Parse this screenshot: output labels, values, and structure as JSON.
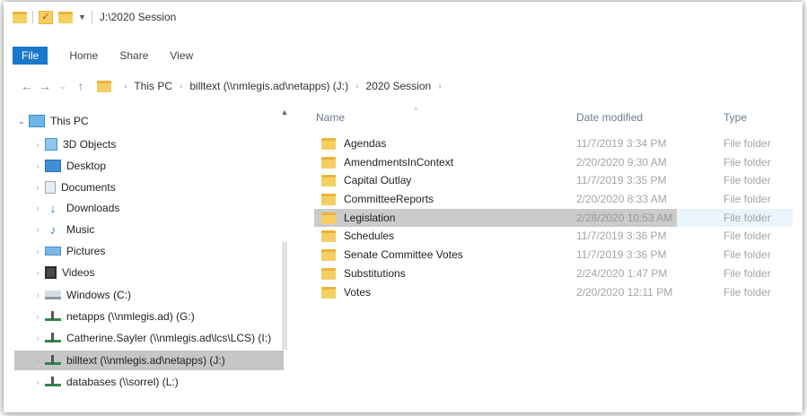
{
  "window": {
    "title": "J:\\2020 Session"
  },
  "ribbon": {
    "tabs": [
      "File",
      "Home",
      "Share",
      "View"
    ]
  },
  "address": {
    "crumbs": [
      "This PC",
      "billtext (\\\\nmlegis.ad\\netapps) (J:)",
      "2020 Session"
    ]
  },
  "nav": {
    "items": [
      {
        "label": "This PC",
        "icon": "pc-icon",
        "expanded": true
      },
      {
        "label": "3D Objects",
        "icon": "3d-objects-icon"
      },
      {
        "label": "Desktop",
        "icon": "desktop-icon"
      },
      {
        "label": "Documents",
        "icon": "documents-icon"
      },
      {
        "label": "Downloads",
        "icon": "downloads-icon"
      },
      {
        "label": "Music",
        "icon": "music-icon"
      },
      {
        "label": "Pictures",
        "icon": "pictures-icon"
      },
      {
        "label": "Videos",
        "icon": "videos-icon"
      },
      {
        "label": "Windows (C:)",
        "icon": "drive-icon"
      },
      {
        "label": "netapps (\\\\nmlegis.ad) (G:)",
        "icon": "network-drive-icon"
      },
      {
        "label": "Catherine.Sayler (\\\\nmlegis.ad\\lcs\\LCS) (I:)",
        "icon": "network-drive-icon"
      },
      {
        "label": "billtext (\\\\nmlegis.ad\\netapps) (J:)",
        "icon": "network-drive-icon",
        "selected": true
      },
      {
        "label": "databases (\\\\sorrel) (L:)",
        "icon": "network-drive-icon"
      }
    ]
  },
  "filelist": {
    "columns": {
      "name": "Name",
      "date": "Date modified",
      "type": "Type"
    },
    "rows": [
      {
        "name": "Agendas",
        "date": "11/7/2019 3:34 PM",
        "type": "File folder"
      },
      {
        "name": "AmendmentsInContext",
        "date": "2/20/2020 9:30 AM",
        "type": "File folder"
      },
      {
        "name": "Capital Outlay",
        "date": "11/7/2019 3:35 PM",
        "type": "File folder"
      },
      {
        "name": "CommitteeReports",
        "date": "2/20/2020 8:33 AM",
        "type": "File folder"
      },
      {
        "name": "Legislation",
        "date": "2/28/2020 10:53 AM",
        "type": "File folder",
        "selected": true
      },
      {
        "name": "Schedules",
        "date": "11/7/2019 3:36 PM",
        "type": "File folder"
      },
      {
        "name": "Senate Committee Votes",
        "date": "11/7/2019 3:36 PM",
        "type": "File folder"
      },
      {
        "name": "Substitutions",
        "date": "2/24/2020 1:47 PM",
        "type": "File folder"
      },
      {
        "name": "Votes",
        "date": "2/20/2020 12:11 PM",
        "type": "File folder"
      }
    ]
  },
  "colors": {
    "file_tab": "#1979ca",
    "selection": "#cbcbcb",
    "folder": "#f5cf62"
  }
}
